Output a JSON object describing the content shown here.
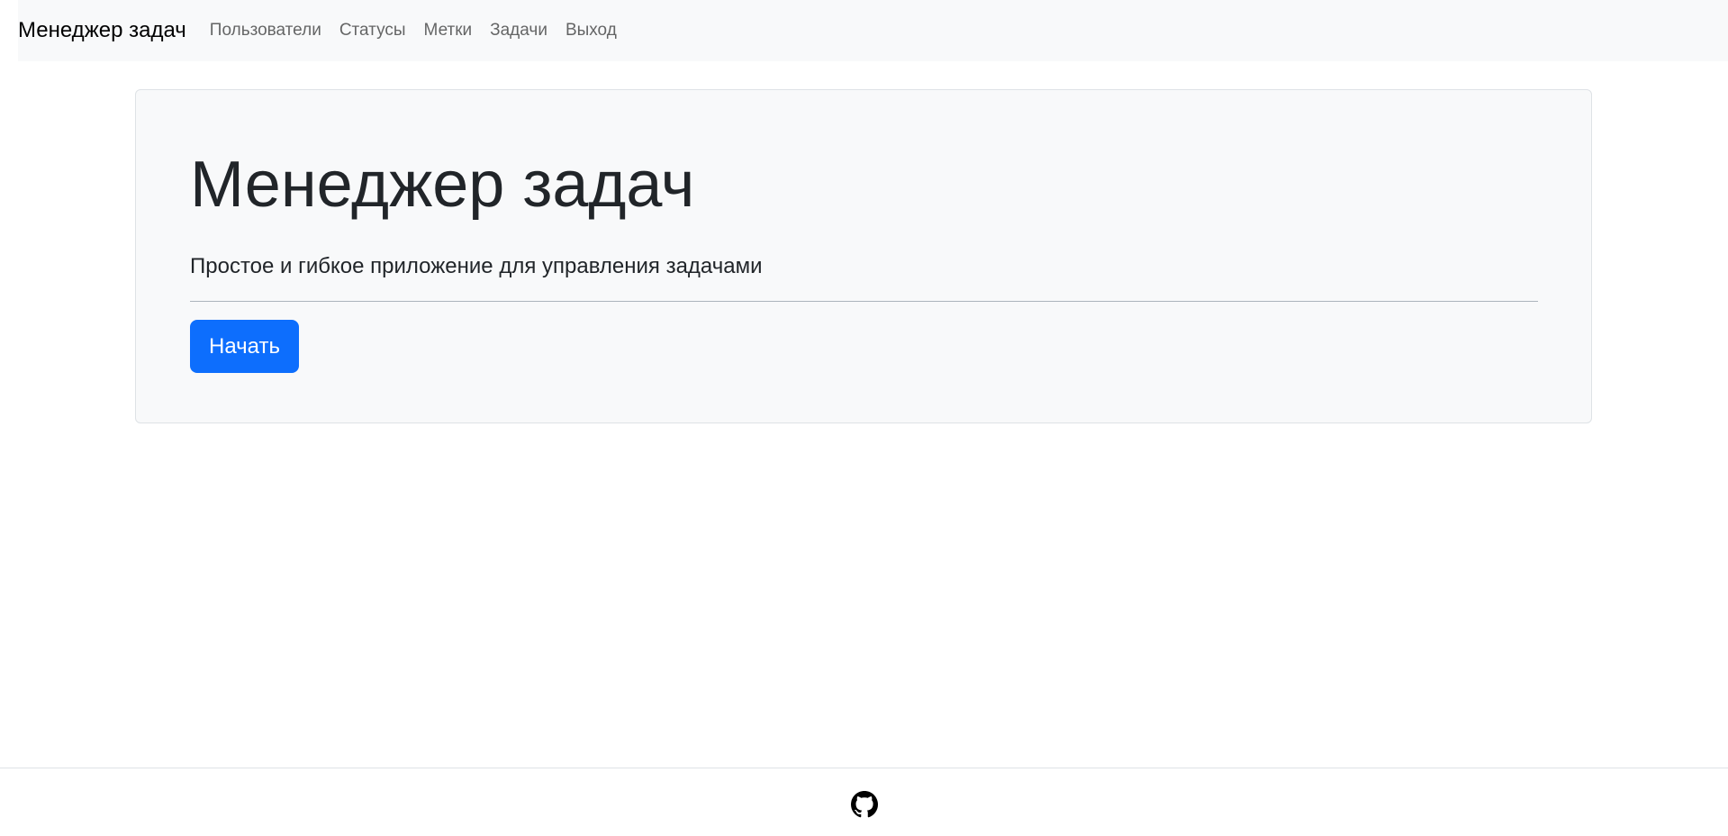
{
  "navbar": {
    "brand": "Менеджер задач",
    "links": [
      {
        "label": "Пользователи"
      },
      {
        "label": "Статусы"
      },
      {
        "label": "Метки"
      },
      {
        "label": "Задачи"
      },
      {
        "label": "Выход"
      }
    ]
  },
  "hero": {
    "title": "Менеджер задач",
    "lead": "Простое и гибкое приложение для управления задачами",
    "button_label": "Начать",
    "button_color": "#0d6efd"
  },
  "footer": {
    "icon": "github-icon"
  }
}
